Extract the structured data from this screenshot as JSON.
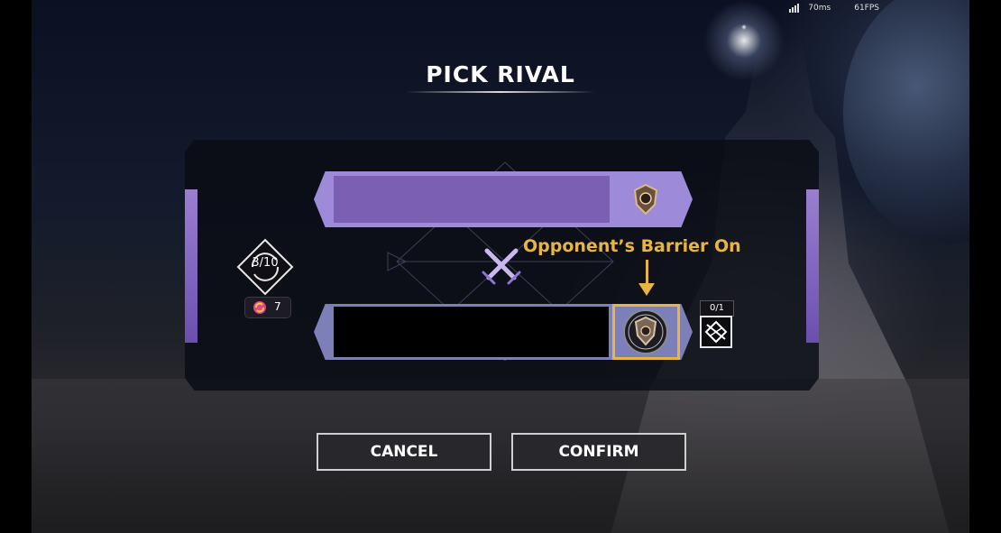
{
  "hud": {
    "ping": "70ms",
    "fps": "61FPS"
  },
  "title": "PICK RIVAL",
  "annotation": "Opponent’s Barrier On",
  "rival_counter": "3/10",
  "refresh_count": "7",
  "barrier": {
    "count": "0/1",
    "icon": "barrier-broken-icon"
  },
  "icons": {
    "top_slot_badge": "rank-shield-icon",
    "bottom_slot_badge": "barrier-shield-icon",
    "versus": "crossed-swords-icon",
    "refresh": "refresh-icon"
  },
  "colors": {
    "accent_purple": "#9d8ad8",
    "highlight_gold": "#e8b543"
  },
  "buttons": {
    "cancel": "CANCEL",
    "confirm": "CONFIRM"
  }
}
